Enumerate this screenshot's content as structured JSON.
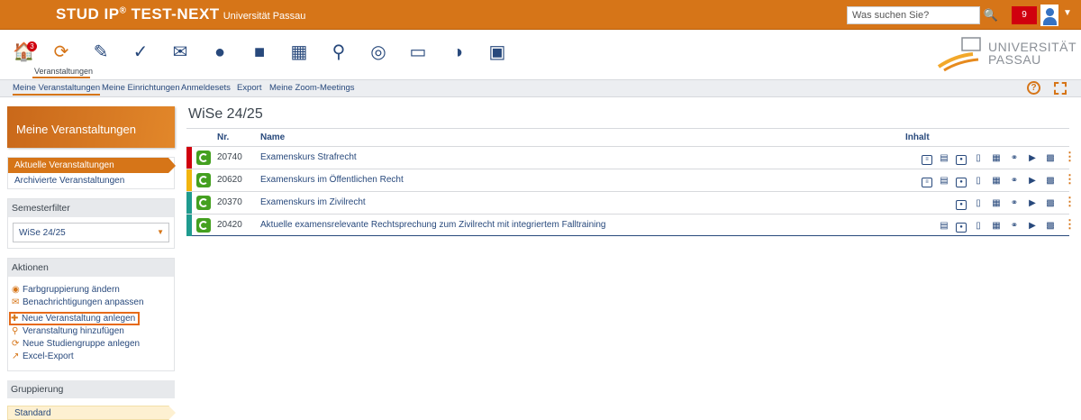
{
  "topbar": {
    "brand": "STUD IP",
    "brand_sup": "®",
    "instance": "TEST-NEXT",
    "university": "Universität Passau",
    "search_placeholder": "Was suchen Sie?",
    "notification_count": "9"
  },
  "nav": {
    "badge_count": "3",
    "active_label": "Veranstaltungen",
    "university_logo_text": "UNIVERSITÄT PASSAU"
  },
  "subnav": {
    "items": [
      "Meine Veranstaltungen",
      "Meine Einrichtungen",
      "Anmeldesets",
      "Export",
      "Meine Zoom-Meetings"
    ]
  },
  "sidebar": {
    "title": "Meine Veranstaltungen",
    "views": [
      "Aktuelle Veranstaltungen",
      "Archivierte Veranstaltungen"
    ],
    "semesterfilter": {
      "title": "Semesterfilter",
      "value": "WiSe 24/25"
    },
    "actions": {
      "title": "Aktionen",
      "items": [
        "Farbgruppierung ändern",
        "Benachrichtigungen anpassen",
        "Neue Veranstaltung anlegen",
        "Veranstaltung hinzufügen",
        "Neue Studiengruppe anlegen",
        "Excel-Export"
      ]
    },
    "grouping": {
      "title": "Gruppierung",
      "value": "Standard"
    }
  },
  "main": {
    "semester": "WiSe 24/25",
    "columns": {
      "nr": "Nr.",
      "name": "Name",
      "content": "Inhalt"
    },
    "courses": [
      {
        "nr": "20740",
        "name": "Examenskurs Strafrecht",
        "color": "#d0000e"
      },
      {
        "nr": "20620",
        "name": "Examenskurs im Öffentlichen Recht",
        "color": "#f2b50f"
      },
      {
        "nr": "20370",
        "name": "Examenskurs im Zivilrecht",
        "color": "#1f9b8f"
      },
      {
        "nr": "20420",
        "name": "Aktuelle examensrelevante Rechtsprechung zum Zivilrecht mit integriertem Falltraining",
        "color": "#1f9b8f"
      }
    ]
  },
  "colors": {
    "accent": "#d67518",
    "link": "#28497c",
    "success": "#44a020"
  }
}
